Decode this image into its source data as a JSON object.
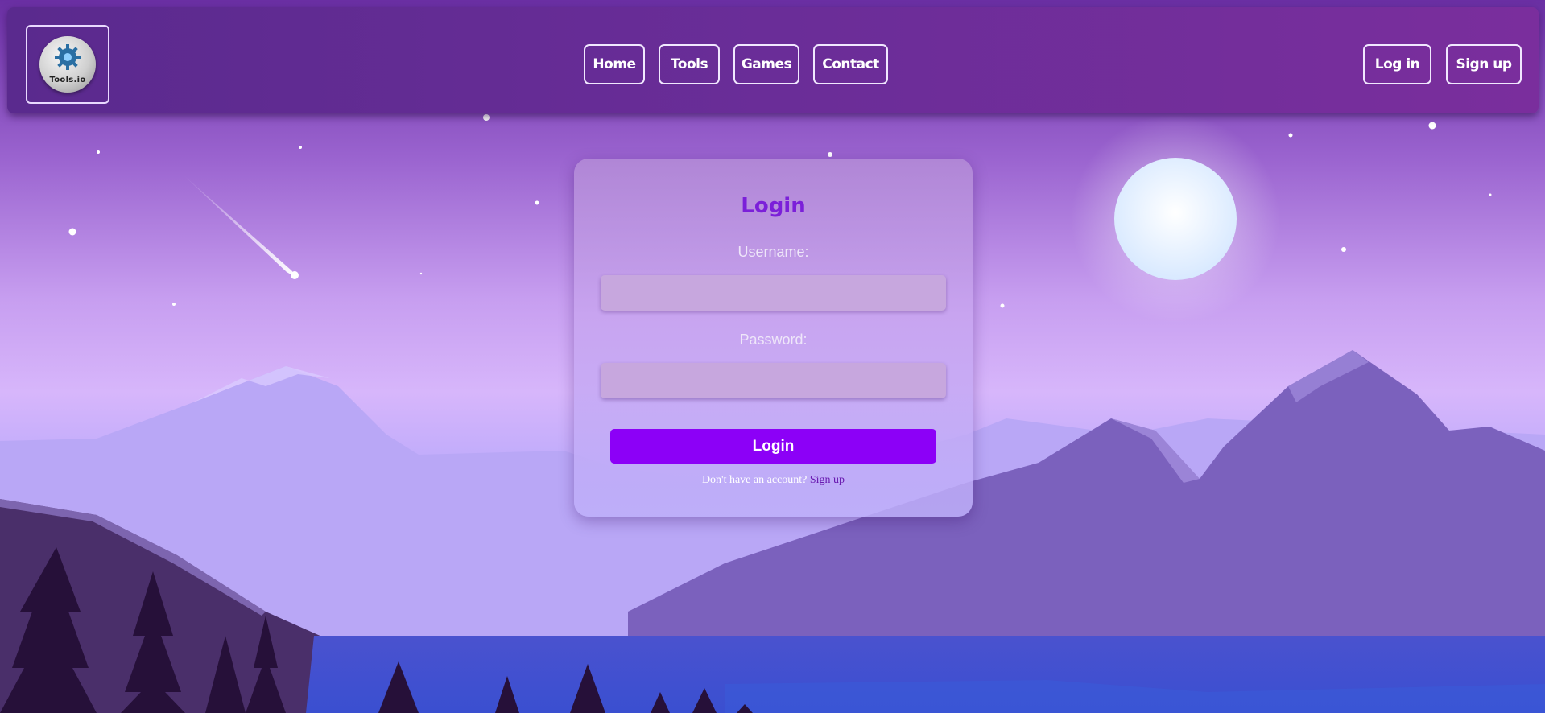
{
  "brand": {
    "logo_text": "Tools.io"
  },
  "nav": {
    "links": [
      {
        "label": "Home"
      },
      {
        "label": "Tools"
      },
      {
        "label": "Games"
      },
      {
        "label": "Contact"
      }
    ],
    "auth": {
      "login_label": "Log in",
      "signup_label": "Sign up"
    }
  },
  "login_form": {
    "title": "Login",
    "username_label": "Username:",
    "password_label": "Password:",
    "username_value": "",
    "password_value": "",
    "submit_label": "Login",
    "signup_prompt": "Don't have an account?",
    "signup_link": "Sign up"
  },
  "colors": {
    "accent": "#8c00f7",
    "title": "#7b1fd9",
    "navbar": "#6a2d98"
  }
}
